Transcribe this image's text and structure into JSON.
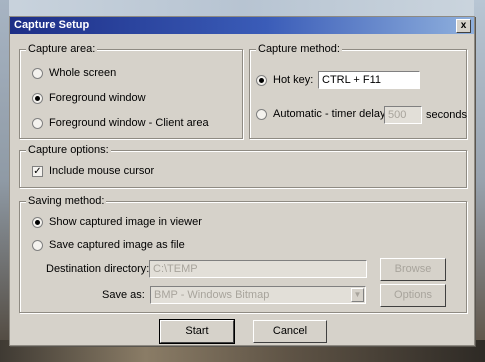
{
  "window": {
    "title": "Capture Setup",
    "close_label": "x"
  },
  "capture_area": {
    "label": "Capture area:",
    "options": [
      {
        "label": "Whole screen",
        "selected": false
      },
      {
        "label": "Foreground window",
        "selected": true
      },
      {
        "label": "Foreground window - Client area",
        "selected": false
      }
    ]
  },
  "capture_method": {
    "label": "Capture method:",
    "hotkey_label": "Hot key:",
    "hotkey_value": "CTRL + F11",
    "hotkey_selected": true,
    "automatic_label": "Automatic - timer delay:",
    "automatic_value": "500",
    "automatic_selected": false,
    "seconds_label": "seconds"
  },
  "capture_options": {
    "label": "Capture options:",
    "include_cursor_label": "Include mouse cursor",
    "include_cursor_checked": true,
    "check_glyph": "✓"
  },
  "saving_method": {
    "label": "Saving method:",
    "show_viewer_label": "Show captured image in viewer",
    "show_viewer_selected": true,
    "save_file_label": "Save captured image as file",
    "save_file_selected": false,
    "destination_label": "Destination directory:",
    "destination_value": "C:\\TEMP",
    "browse_label": "Browse",
    "save_as_label": "Save as:",
    "save_as_value": "BMP - Windows Bitmap",
    "options_label": "Options"
  },
  "buttons": {
    "start": "Start",
    "cancel": "Cancel"
  },
  "icons": {
    "dropdown": "chevron-down-icon",
    "close": "close-icon"
  }
}
